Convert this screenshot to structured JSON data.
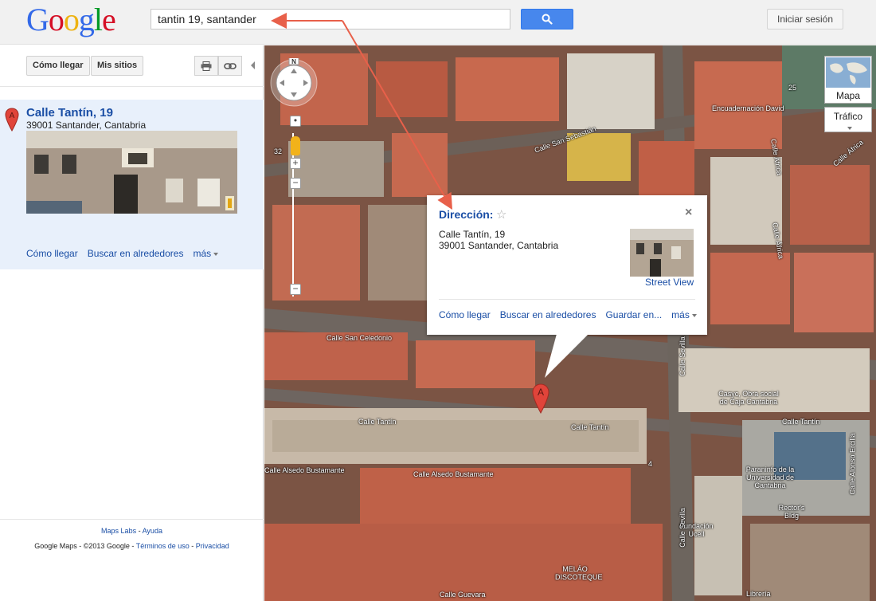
{
  "header": {
    "logo_letters": [
      "G",
      "o",
      "o",
      "g",
      "l",
      "e"
    ],
    "search_value": "tantin 19, santander",
    "signin_label": "Iniciar sesión"
  },
  "toolbar": {
    "directions_label": "Cómo llegar",
    "my_places_label": "Mis sitios"
  },
  "result": {
    "marker_letter": "A",
    "title": "Calle Tantín, 19",
    "address": "39001 Santander, Cantabria",
    "links": {
      "directions": "Cómo llegar",
      "nearby": "Buscar en alrededores",
      "more": "más"
    }
  },
  "footer": {
    "maps_labs": "Maps Labs",
    "separator": " - ",
    "help": "Ayuda",
    "copyright": "Google Maps - ©2013 Google - ",
    "terms": "Términos de uso",
    "privacy": "Privacidad"
  },
  "map": {
    "maptype_label": "Mapa",
    "traffic_label": "Tráfico",
    "compass_n": "N",
    "street_labels": [
      "Calle San Sebastián",
      "Calle San Celedonio",
      "Calle Tantín",
      "Calle Tantín",
      "Calle Alsedo Bustamante",
      "Calle Alsedo Bustamante",
      "Calle Sevilla",
      "Calle África",
      "Calle África",
      "Calle África",
      "Calle Tantín",
      "Calle Alonso Ercilla",
      "Encuadernación David",
      "Casyc, Obra social de Caja Cantabria",
      "Paraninfo de la Universidad de Cantabria",
      "Rector's Bldg",
      "Fundación Ucell",
      "MELÁO DISCOTEQUE",
      "Calle Guevara",
      "Calle Sevilla",
      "Librería",
      "25",
      "32",
      "4"
    ]
  },
  "bubble": {
    "title": "Dirección:",
    "address_line1": "Calle Tantín, 19",
    "address_line2": "39001 Santander, Cantabria",
    "street_view": "Street View",
    "links": {
      "directions": "Cómo llegar",
      "nearby": "Buscar en alrededores",
      "save": "Guardar en...",
      "more": "más"
    },
    "marker_letter": "A"
  },
  "colors": {
    "link": "#1a4ea5",
    "search_button": "#4787ed",
    "annotation_arrow": "#e8604a",
    "marker": "#e0443a"
  }
}
